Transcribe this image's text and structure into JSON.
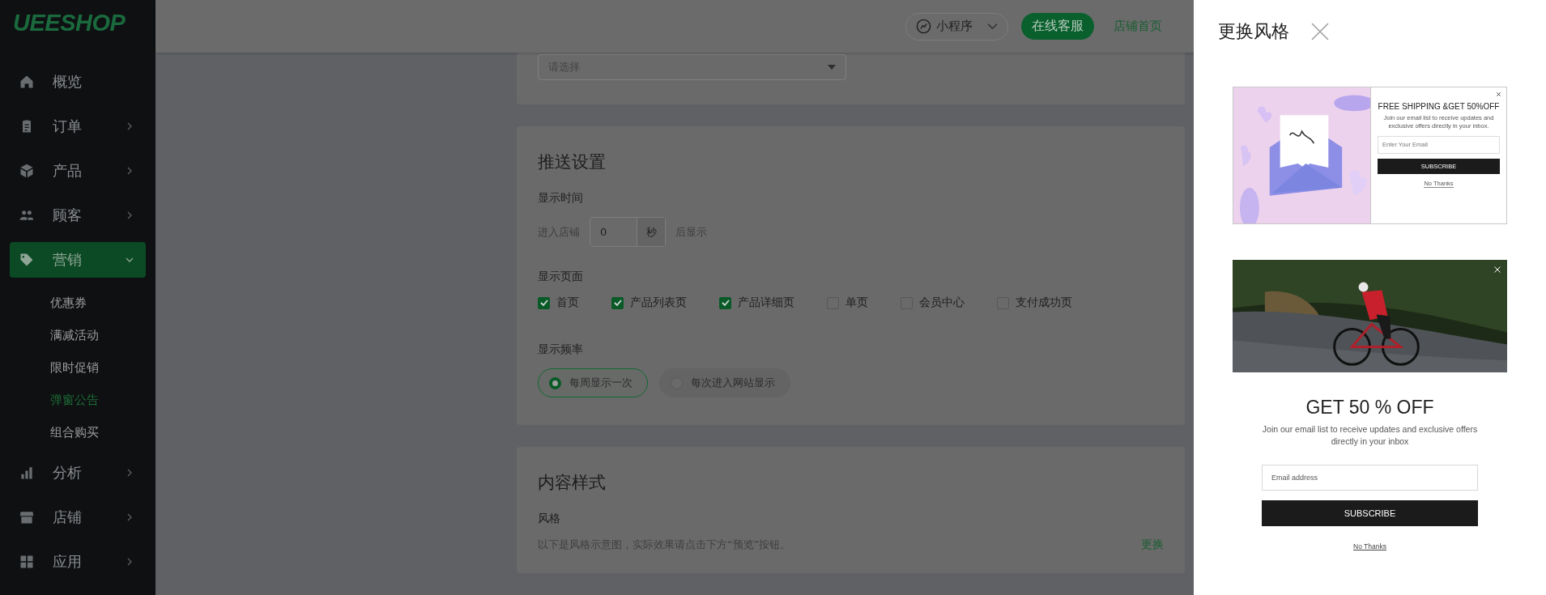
{
  "sidebar": {
    "logo": "UEESHOP",
    "items": [
      {
        "label": "概览",
        "selected": false
      },
      {
        "label": "订单",
        "selected": false,
        "expanded": false
      },
      {
        "label": "产品",
        "selected": false,
        "expanded": false
      },
      {
        "label": "顾客",
        "selected": false,
        "expanded": false
      },
      {
        "label": "营销",
        "selected": true,
        "expanded": true,
        "children": [
          {
            "label": "优惠券",
            "selected": false
          },
          {
            "label": "满减活动",
            "selected": false
          },
          {
            "label": "限时促销",
            "selected": false
          },
          {
            "label": "弹窗公告",
            "selected": true
          },
          {
            "label": "组合购买",
            "selected": false
          }
        ]
      },
      {
        "label": "分析",
        "selected": false,
        "expanded": false
      },
      {
        "label": "店铺",
        "selected": false,
        "expanded": false
      },
      {
        "label": "应用",
        "selected": false,
        "expanded": false
      }
    ]
  },
  "topbar": {
    "mini_program": "小程序",
    "support_button": "在线客服",
    "store_link": "店铺首页"
  },
  "select_card": {
    "placeholder": "请选择"
  },
  "push_settings": {
    "title": "推送设置",
    "display_time": {
      "label": "显示时间",
      "prefix": "进入店铺",
      "value": "0",
      "unit": "秒",
      "suffix": "后显示"
    },
    "display_pages": {
      "label": "显示页面",
      "options": [
        {
          "label": "首页",
          "checked": true
        },
        {
          "label": "产品列表页",
          "checked": true
        },
        {
          "label": "产品详细页",
          "checked": true
        },
        {
          "label": "单页",
          "checked": false
        },
        {
          "label": "会员中心",
          "checked": false
        },
        {
          "label": "支付成功页",
          "checked": false
        }
      ]
    },
    "frequency": {
      "label": "显示频率",
      "options": [
        {
          "label": "每周显示一次",
          "selected": true
        },
        {
          "label": "每次进入网站显示",
          "selected": false
        }
      ]
    }
  },
  "content_style": {
    "title": "内容样式",
    "style_label": "风格",
    "hint": "以下是风格示意图，实际效果请点击下方“预览”按钮。",
    "change_link": "更换"
  },
  "drawer": {
    "title": "更换风格",
    "templates": [
      {
        "kind": "split",
        "heading": "FREE SHIPPING &GET 50%OFF",
        "text": "Join our email list to receive updates and exclusive offers directly in your inbox.",
        "placeholder": "Enter Your Email",
        "button": "SUBSCRIBE",
        "decline": "No Thanks"
      },
      {
        "kind": "banner",
        "heading": "GET 50 % OFF",
        "text": "Join our email list to receive updates and exclusive offers directly in your inbox",
        "placeholder": "Email address",
        "button": "SUBSCRIBE",
        "decline": "No Thanks"
      }
    ]
  }
}
